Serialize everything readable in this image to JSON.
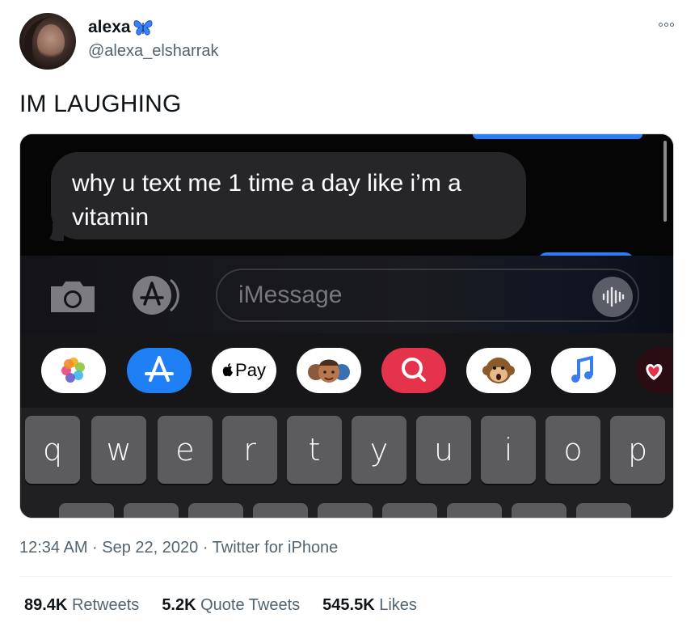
{
  "author": {
    "display_name": "alexa",
    "badge_emoji": "butterfly-icon",
    "handle": "@alexa_elsharrak"
  },
  "tweet": {
    "text": "IM LAUGHING",
    "timestamp": "12:34 AM · Sep 22, 2020 · Twitter for iPhone"
  },
  "media": {
    "received_message": "why u text me 1 time a day like i’m a vitamin",
    "input_placeholder": "iMessage",
    "apple_pay_label": "Pay",
    "keys": [
      "q",
      "w",
      "e",
      "r",
      "t",
      "y",
      "u",
      "i",
      "o",
      "p"
    ],
    "colors": {
      "bubble_sent": "#2e7cf6",
      "bubble_received": "#262628",
      "keyboard_bg": "#202022",
      "key_bg": "#5c5c5f"
    }
  },
  "stats": {
    "retweets_count": "89.4K",
    "retweets_label": "Retweets",
    "quotes_count": "5.2K",
    "quotes_label": "Quote Tweets",
    "likes_count": "545.5K",
    "likes_label": "Likes"
  },
  "colors": {
    "butterfly": "#3b82f6",
    "muted_text": "#536471"
  }
}
